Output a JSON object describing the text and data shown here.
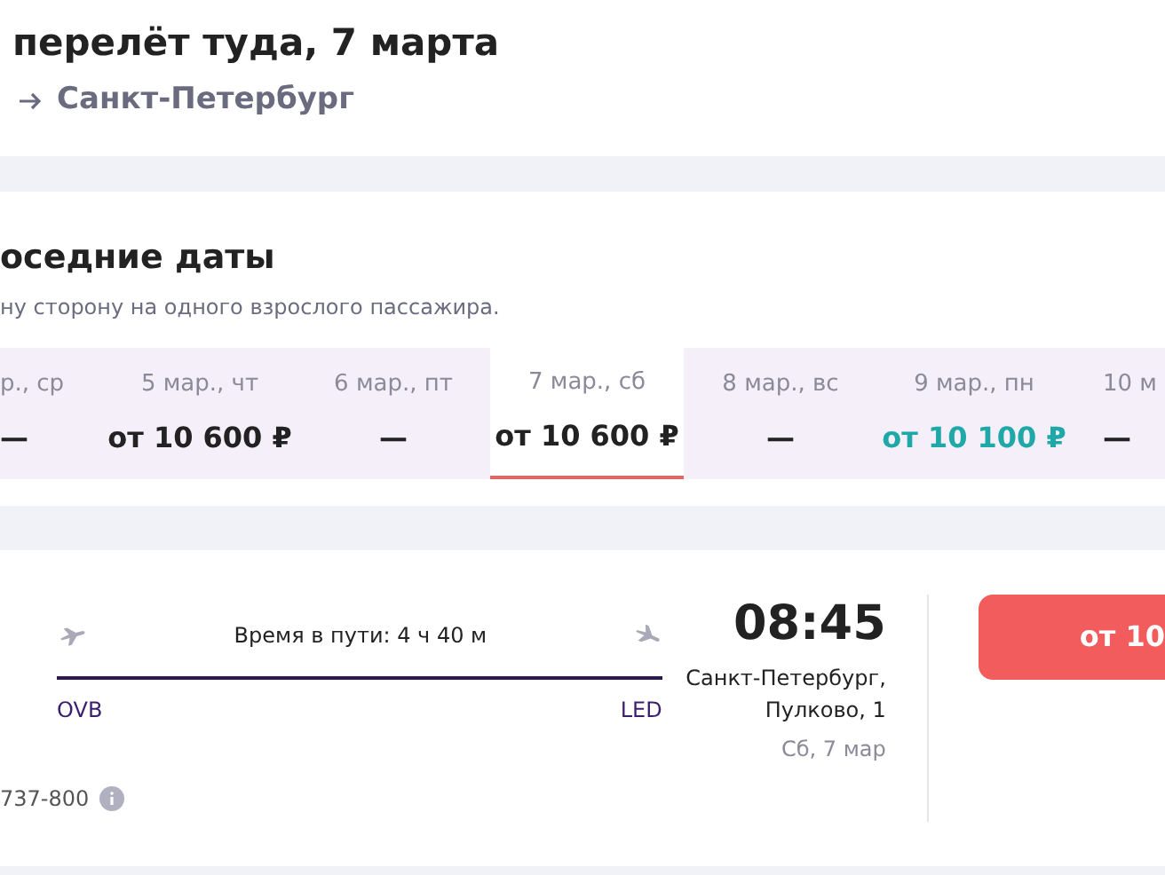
{
  "header": {
    "title": "перелёт туда, 7 марта",
    "destination": "Санкт-Петербург"
  },
  "nearby": {
    "title": "оседние даты",
    "subtitle": "ну сторону на одного взрослого пассажира.",
    "dates": [
      {
        "kind": "start",
        "label": "р., ср",
        "price": "—",
        "selected": false,
        "cheapest": false
      },
      {
        "kind": "full",
        "label": "5 мар., чт",
        "price": "от 10 600 ₽",
        "selected": false,
        "cheapest": false
      },
      {
        "kind": "full",
        "label": "6 мар., пт",
        "price": "—",
        "selected": false,
        "cheapest": false
      },
      {
        "kind": "full",
        "label": "7 мар., сб",
        "price": "от 10 600 ₽",
        "selected": true,
        "cheapest": false
      },
      {
        "kind": "full",
        "label": "8 мар., вс",
        "price": "—",
        "selected": false,
        "cheapest": false
      },
      {
        "kind": "full",
        "label": "9 мар., пн",
        "price": "от 10 100 ₽",
        "selected": false,
        "cheapest": true
      },
      {
        "kind": "end",
        "label": "10 м",
        "price": "—",
        "selected": false,
        "cheapest": false
      }
    ]
  },
  "flight": {
    "duration": "Время в пути: 4 ч 40 м",
    "from_code": "OVB",
    "to_code": "LED",
    "arrival_time": "08:45",
    "arrival_place": "Санкт-Петербург,\nПулково, 1",
    "arrival_date": "Сб, 7 мар",
    "aircraft": "737-800",
    "buy": "от 10"
  }
}
